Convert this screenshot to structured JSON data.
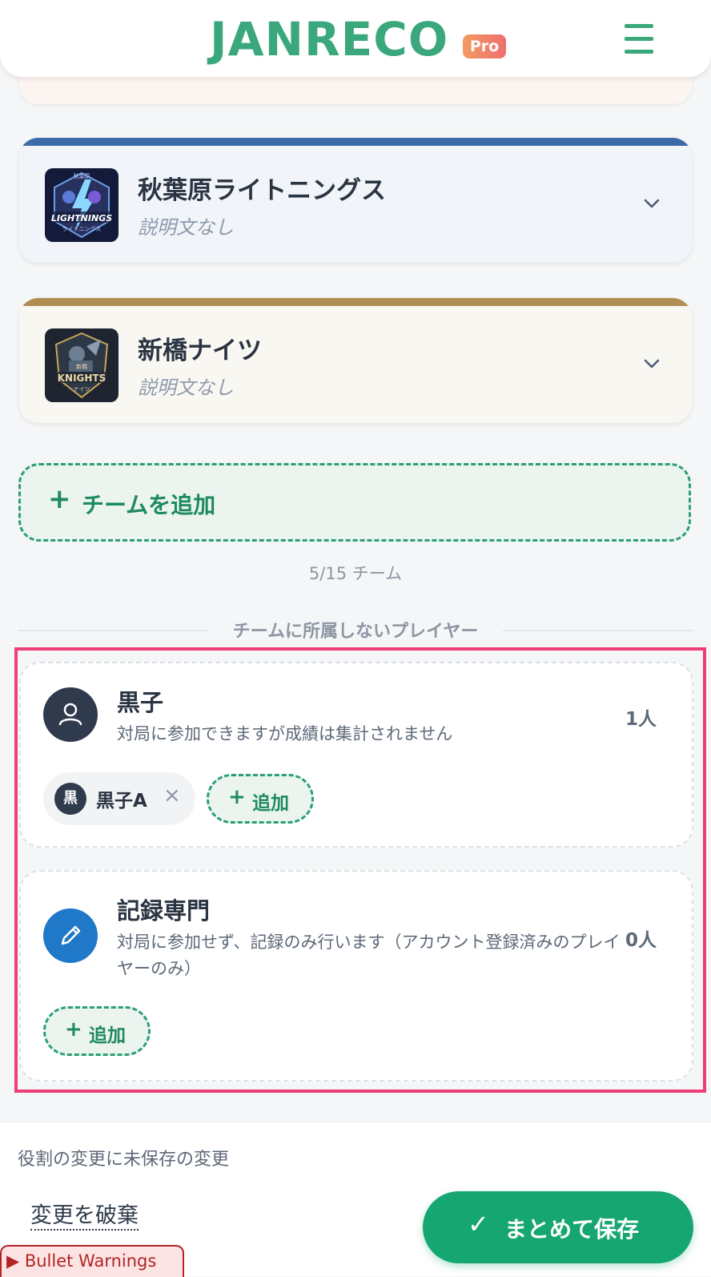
{
  "header": {
    "logo_text": "JANRECO",
    "badge": "Pro",
    "menu_icon": "hamburger-menu-icon",
    "brand_color": "#3aa87c"
  },
  "teams": [
    {
      "name": "秋葉原ライトニングス",
      "description": "説明文なし",
      "logo_text": "LIGHTNINGS",
      "logo_subtext": "ライトニングス",
      "logo_toptext": "秋葉原",
      "accent": "#3b6aa6",
      "bg": "#f1f4f9"
    },
    {
      "name": "新橋ナイツ",
      "description": "説明文なし",
      "logo_text": "KNIGHTS",
      "logo_subtext": "ナイツ",
      "logo_toptext": "新橋",
      "accent": "#b08d52",
      "bg": "#f9f7f2"
    }
  ],
  "add_team": {
    "plus": "+",
    "label": "チームを追加"
  },
  "team_count": "5/15 チーム",
  "unaffiliated_heading": "チームに所属しないプレイヤー",
  "roles": [
    {
      "title": "黒子",
      "description": "対局に参加できますが成績は集計されません",
      "count": "1人",
      "icon": "person-icon",
      "icon_color": "#2f3a4c",
      "players": [
        {
          "avatar": "黒",
          "name": "黒子A",
          "remove": "×"
        }
      ],
      "add_label": "追加",
      "add_plus": "+"
    },
    {
      "title": "記録専門",
      "description": "対局に参加せず、記録のみ行います（アカウント登録済みのプレイヤーのみ）",
      "count": "0人",
      "icon": "pencil-icon",
      "icon_color": "#1f78c8",
      "players": [],
      "add_label": "追加",
      "add_plus": "+"
    }
  ],
  "bottom_bar": {
    "unsaved": "役割の変更に未保存の変更",
    "discard": "変更を破棄",
    "save_check": "✓",
    "save": "まとめて保存",
    "save_color": "#15a672"
  },
  "warnings": {
    "label": "▶ Bullet Warnings"
  }
}
